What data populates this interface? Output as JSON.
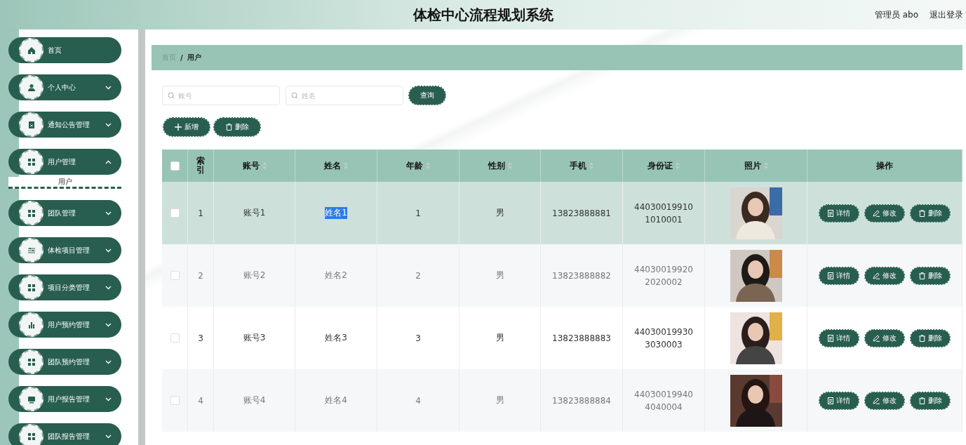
{
  "header": {
    "title": "体检中心流程规划系统",
    "user": "管理员 abo",
    "logout": "退出登录"
  },
  "sidebar": {
    "items": [
      {
        "label": "首页"
      },
      {
        "label": "个人中心",
        "expanded": false
      },
      {
        "label": "通知公告管理",
        "expanded": false
      },
      {
        "label": "用户管理",
        "expanded": true,
        "children": [
          {
            "label": "用户",
            "selected": true
          }
        ]
      },
      {
        "label": "团队管理",
        "expanded": false
      },
      {
        "label": "体检项目管理",
        "expanded": false
      },
      {
        "label": "项目分类管理",
        "expanded": false
      },
      {
        "label": "用户预约管理",
        "expanded": false
      },
      {
        "label": "团队预约管理",
        "expanded": false
      },
      {
        "label": "用户报告管理",
        "expanded": false
      },
      {
        "label": "团队报告管理",
        "expanded": false
      }
    ]
  },
  "breadcrumb": {
    "items": [
      "首页",
      "用户"
    ],
    "separator": "/"
  },
  "search": {
    "fields": [
      {
        "placeholder": "账号"
      },
      {
        "placeholder": "姓名"
      }
    ],
    "button": "查询"
  },
  "actions": [
    "新增",
    "删除"
  ],
  "table": {
    "columns": [
      {
        "label": "索引",
        "sortable": false
      },
      {
        "label": "账号",
        "sortable": true
      },
      {
        "label": "姓名",
        "sortable": true
      },
      {
        "label": "年龄",
        "sortable": true
      },
      {
        "label": "性别",
        "sortable": true
      },
      {
        "label": "手机",
        "sortable": true
      },
      {
        "label": "身份证",
        "sortable": true
      },
      {
        "label": "照片",
        "sortable": true
      },
      {
        "label": "操作",
        "sortable": false
      }
    ],
    "header_checked": false,
    "rows": [
      {
        "index": "1",
        "account": "账号1",
        "name": "姓名1",
        "age": "1",
        "gender": "男",
        "phone": "13823888881",
        "id_card": "440300199101010001",
        "hovered": true,
        "name_highlighted": true,
        "checked": false,
        "actions": [
          "详情",
          "修改",
          "删除"
        ]
      },
      {
        "index": "2",
        "account": "账号2",
        "name": "姓名2",
        "age": "2",
        "gender": "男",
        "phone": "13823888882",
        "id_card": "440300199202020002",
        "hovered": false,
        "name_highlighted": false,
        "checked": false,
        "actions": [
          "详情",
          "修改",
          "删除"
        ]
      },
      {
        "index": "3",
        "account": "账号3",
        "name": "姓名3",
        "age": "3",
        "gender": "男",
        "phone": "13823888883",
        "id_card": "440300199303030003",
        "hovered": false,
        "name_highlighted": false,
        "checked": false,
        "actions": [
          "详情",
          "修改",
          "删除"
        ]
      },
      {
        "index": "4",
        "account": "账号4",
        "name": "姓名4",
        "age": "4",
        "gender": "男",
        "phone": "13823888884",
        "id_card": "440300199404040004",
        "hovered": false,
        "name_highlighted": false,
        "checked": false,
        "actions": [
          "详情",
          "修改",
          "删除"
        ]
      }
    ]
  }
}
